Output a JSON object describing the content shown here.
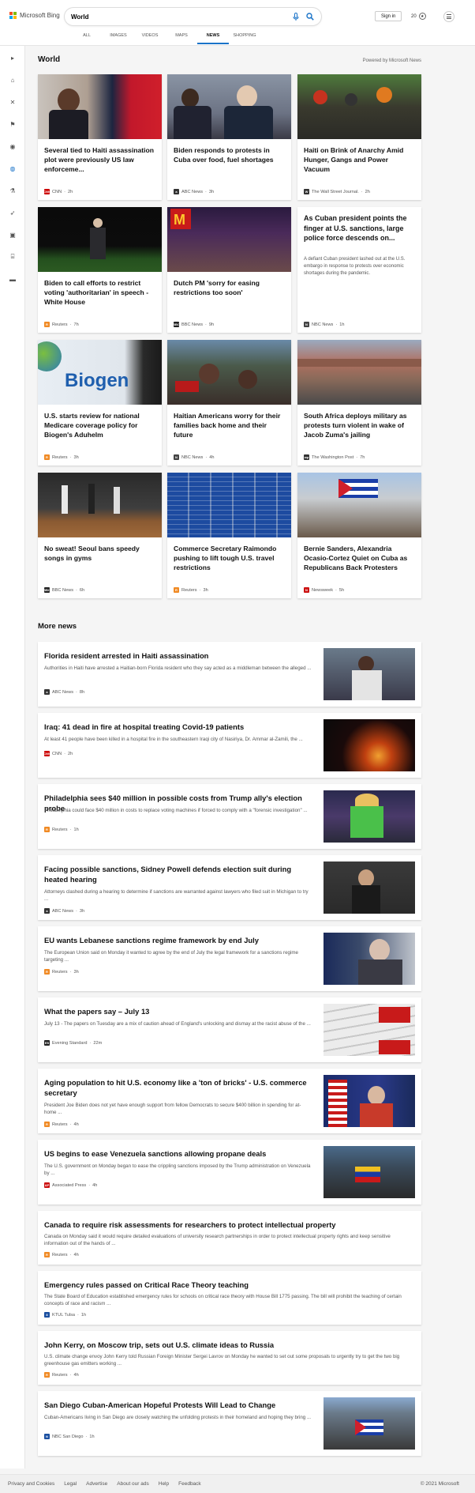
{
  "header": {
    "brand": "Microsoft Bing",
    "search_value": "World",
    "signin_label": "Sign in",
    "points": "20",
    "tabs": [
      "ALL",
      "IMAGES",
      "VIDEOS",
      "MAPS",
      "NEWS",
      "SHOPPING"
    ],
    "active_tab": "NEWS"
  },
  "section": {
    "title": "World",
    "powered_by": "Powered by Microsoft News"
  },
  "cards": [
    {
      "title": "Several tied to Haiti assassination plot were previously US law enforceme...",
      "source": "CNN",
      "age": "2h",
      "src_color": "#cc0000",
      "src_icon": "CNN"
    },
    {
      "title": "Biden responds to protests in Cuba over food, fuel shortages",
      "source": "ABC News",
      "age": "3h",
      "src_color": "#333333",
      "src_icon": "a"
    },
    {
      "title": "Haiti on Brink of Anarchy Amid Hunger, Gangs and Power Vacuum",
      "source": "The Wall Street Journal.",
      "age": "2h",
      "src_color": "#333333",
      "src_icon": "W"
    },
    {
      "title": "Biden to call efforts to restrict voting 'authoritarian' in speech - White House",
      "source": "Reuters",
      "age": "7h",
      "src_color": "#f08a24",
      "src_icon": "R"
    },
    {
      "title": "Dutch PM 'sorry for easing restrictions too soon'",
      "source": "BBC News",
      "age": "9h",
      "src_color": "#222222",
      "src_icon": "BBC"
    },
    {
      "title": "As Cuban president points the finger at U.S. sanctions, large police force descends on...",
      "desc": "A defiant Cuban president lashed out at the U.S. embargo in response to protests over economic shortages during the pandemic.",
      "source": "NBC News",
      "age": "1h",
      "src_color": "#444444",
      "src_icon": "N"
    },
    {
      "title": "U.S. starts review for national Medicare coverage policy for Biogen's Aduhelm",
      "source": "Reuters",
      "age": "3h",
      "src_color": "#f08a24",
      "src_icon": "R"
    },
    {
      "title": "Haitian Americans worry for their families back home and their future",
      "source": "NBC News",
      "age": "4h",
      "src_color": "#444444",
      "src_icon": "N"
    },
    {
      "title": "South Africa deploys military as protests turn violent in wake of Jacob Zuma's jailing",
      "source": "The Washington Post",
      "age": "7h",
      "src_color": "#333333",
      "src_icon": "wp"
    },
    {
      "title": "No sweat! Seoul bans speedy songs in gyms",
      "source": "BBC News",
      "age": "6h",
      "src_color": "#222222",
      "src_icon": "BBC"
    },
    {
      "title": "Commerce Secretary Raimondo pushing to lift tough U.S. travel restrictions",
      "source": "Reuters",
      "age": "3h",
      "src_color": "#f08a24",
      "src_icon": "R"
    },
    {
      "title": "Bernie Sanders, Alexandria Ocasio-Cortez Quiet on Cuba as Republicans Back Protesters",
      "source": "Newsweek",
      "age": "5h",
      "src_color": "#cc1111",
      "src_icon": "N"
    }
  ],
  "more_news_title": "More news",
  "more_news": [
    {
      "title": "Florida resident arrested in Haiti assassination",
      "desc": "Authorities in Haiti have arrested a Haitian-born Florida resident who they say acted as a middleman between the alleged ...",
      "source": "ABC News",
      "age": "8h",
      "src_color": "#333333",
      "src_icon": "a"
    },
    {
      "title": "Iraq: 41 dead in fire at hospital treating Covid-19 patients",
      "desc": "At least 41 people have been killed in a hospital fire in the southeastern Iraqi city of Nasiriya, Dr. Ammar al-Zamili, the ...",
      "source": "CNN",
      "age": "2h",
      "src_color": "#cc0000",
      "src_icon": "CNN"
    },
    {
      "title": "Philadelphia sees $40 million in possible costs from Trump ally's election probe",
      "desc": "Philadelphia could face $40 million in costs to replace voting machines if forced to comply with a \"forensic investigation\" ...",
      "source": "Reuters",
      "age": "1h",
      "src_color": "#f08a24",
      "src_icon": "R"
    },
    {
      "title": "Facing possible sanctions, Sidney Powell defends election suit during heated hearing",
      "desc": "Attorneys clashed during a hearing to determine if sanctions are warranted against lawyers who filed suit in Michigan to try ...",
      "source": "ABC News",
      "age": "3h",
      "src_color": "#333333",
      "src_icon": "a"
    },
    {
      "title": "EU wants Lebanese sanctions regime framework by end July",
      "desc": "The European Union said on Monday it wanted to agree by the end of July the legal framework for a sanctions regime targeting ...",
      "source": "Reuters",
      "age": "3h",
      "src_color": "#f08a24",
      "src_icon": "R"
    },
    {
      "title": "What the papers say – July 13",
      "desc": "July 13 - The papers on Tuesday are a mix of caution ahead of England's unlocking and dismay at the racist abuse of the ...",
      "source": "Evening Standard",
      "age": "22m",
      "src_color": "#222222",
      "src_icon": "ES"
    },
    {
      "title": "Aging population to hit U.S. economy like a 'ton of bricks' - U.S. commerce secretary",
      "desc": "President Joe Biden does not yet have enough support from fellow Democrats to secure $400 billion in spending for at-home ...",
      "source": "Reuters",
      "age": "4h",
      "src_color": "#f08a24",
      "src_icon": "R"
    },
    {
      "title": "US begins to ease Venezuela sanctions allowing propane deals",
      "desc": "The U.S. government on Monday began to ease the crippling sanctions imposed by the Trump administration on Venezuela by ...",
      "source": "Associated Press",
      "age": "4h",
      "src_color": "#cc1111",
      "src_icon": "AP"
    },
    {
      "title": "Canada to require risk assessments for researchers to protect intellectual property",
      "desc": "Canada on Monday said it would require detailed evaluations of university research partnerships in order to protect intellectual property rights and keep sensitive information out of the hands of ...",
      "source": "Reuters",
      "age": "4h",
      "src_color": "#f08a24",
      "src_icon": "R"
    },
    {
      "title": "Emergency rules passed on Critical Race Theory teaching",
      "desc": "The State Board of Education established emergency rules for schools on critical race theory with House Bill 1775 passing. The bill will prohibit the teaching of certain concepts of race and racism ...",
      "source": "KTUL Tulsa",
      "age": "1h",
      "src_color": "#1a4fa0",
      "src_icon": "8"
    },
    {
      "title": "John Kerry, on Moscow trip, sets out U.S. climate ideas to Russia",
      "desc": "U.S. climate change envoy John Kerry told Russian Foreign Minister Sergei Lavrov on Monday he wanted to set out some proposals to urgently try to get the two big greenhouse gas emitters working ...",
      "source": "Reuters",
      "age": "4h",
      "src_color": "#f08a24",
      "src_icon": "R"
    },
    {
      "title": "San Diego Cuban-American Hopeful Protests Will Lead to Change",
      "desc": "Cuban-Americans living in San Diego are closely watching the unfolding protests in their homeland and hoping they bring ...",
      "source": "NBC San Diego",
      "age": "1h",
      "src_color": "#1a4fa0",
      "src_icon": "N"
    }
  ],
  "footer": {
    "links": [
      "Privacy and Cookies",
      "Legal",
      "Advertise",
      "About our ads",
      "Help",
      "Feedback"
    ],
    "copyright": "© 2021 Microsoft"
  }
}
